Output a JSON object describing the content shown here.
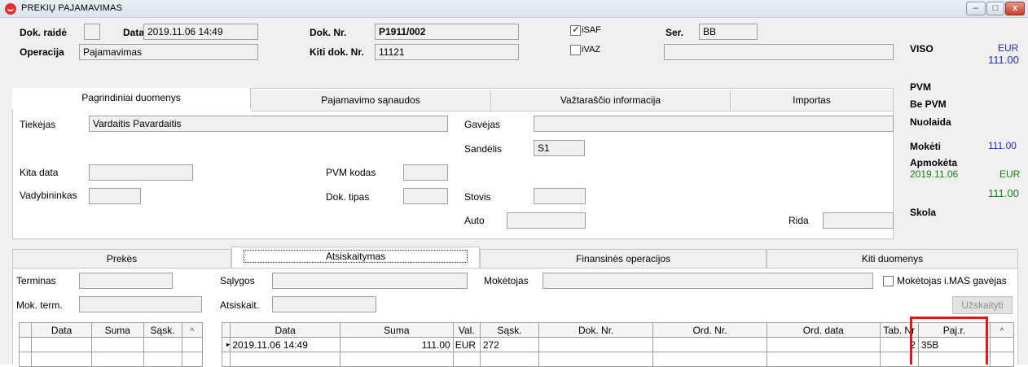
{
  "window": {
    "title": "PREKIŲ PAJAMAVIMAS",
    "minimize_glyph": "–",
    "maximize_glyph": "□",
    "close_glyph": "x"
  },
  "header": {
    "dok_raide_label": "Dok. raidė",
    "dok_raide_value": "",
    "data_label": "Data",
    "data_value": "2019.11.06 14:49",
    "operacija_label": "Operacija",
    "operacija_value": "Pajamavimas",
    "dok_nr_label": "Dok. Nr.",
    "dok_nr_value": "P1911/002",
    "kiti_dok_nr_label": "Kiti dok. Nr.",
    "kiti_dok_nr_value": "11121",
    "isaf_label": "iSAF",
    "isaf_checked": true,
    "ivaz_label": "iVAZ",
    "ivaz_checked": false,
    "ser_label": "Ser.",
    "ser_value": "BB",
    "extra_value": ""
  },
  "main_tabs": [
    {
      "label": "Pagrindiniai duomenys",
      "active": true
    },
    {
      "label": "Pajamavimo sąnaudos",
      "active": false
    },
    {
      "label": "Važtaraščio informacija",
      "active": false
    },
    {
      "label": "Importas",
      "active": false
    }
  ],
  "main_form": {
    "tiekejas_label": "Tiekėjas",
    "tiekejas_value": "Vardaitis Pavardaitis",
    "gavejas_label": "Gavėjas",
    "gavejas_value": "",
    "sandelis_label": "Sandėlis",
    "sandelis_value": "S1",
    "kita_data_label": "Kita data",
    "pvm_kodas_label": "PVM kodas",
    "vadybininkas_label": "Vadybininkas",
    "dok_tipas_label": "Dok. tipas",
    "stovis_label": "Stovis",
    "auto_label": "Auto",
    "rida_label": "Rida"
  },
  "totals": {
    "viso_label": "VISO",
    "currency_top": "EUR",
    "viso_value": "111.00",
    "pvm_label": "PVM",
    "be_pvm_label": "Be PVM",
    "nuolaida_label": "Nuolaida",
    "moketi_label": "Mokėti",
    "moketi_value": "111.00",
    "apmoketa_label": "Apmokėta",
    "apmoketa_date": "2019.11.06",
    "apmoketa_currency": "EUR",
    "apmoketa_value": "111.00",
    "skola_label": "Skola"
  },
  "lower_tabs": [
    {
      "label": "Prekės",
      "active": false
    },
    {
      "label": "Atsiskaitymas",
      "active": true
    },
    {
      "label": "Finansinės operacijos",
      "active": false
    },
    {
      "label": "Kiti duomenys",
      "active": false
    }
  ],
  "payment_form": {
    "terminas_label": "Terminas",
    "mok_term_label": "Mok. term.",
    "salygos_label": "Sąlygos",
    "atsiskait_label": "Atsiskait.",
    "moketojas_label": "Mokėtojas",
    "moketojas_imas_label": "Mokėtojas i.MAS gavėjas",
    "uzskaityti_label": "Užskaityti"
  },
  "left_grid": {
    "columns": [
      "Data",
      "Suma",
      "Sąsk."
    ],
    "scroll_glyph": "^"
  },
  "right_grid": {
    "columns": [
      "Data",
      "Suma",
      "Val.",
      "Sąsk.",
      "Dok. Nr.",
      "Ord. Nr.",
      "Ord. data",
      "Tab. Nr",
      "Paj.r."
    ],
    "scroll_glyph": "^",
    "rows": [
      {
        "marker": "▸",
        "data": "2019.11.06 14:49",
        "suma": "111.00",
        "val": "EUR",
        "sask": "272",
        "dok_nr": "",
        "ord_nr": "",
        "ord_data": "",
        "tab_nr": "2",
        "paj_r": "35B"
      }
    ]
  }
}
